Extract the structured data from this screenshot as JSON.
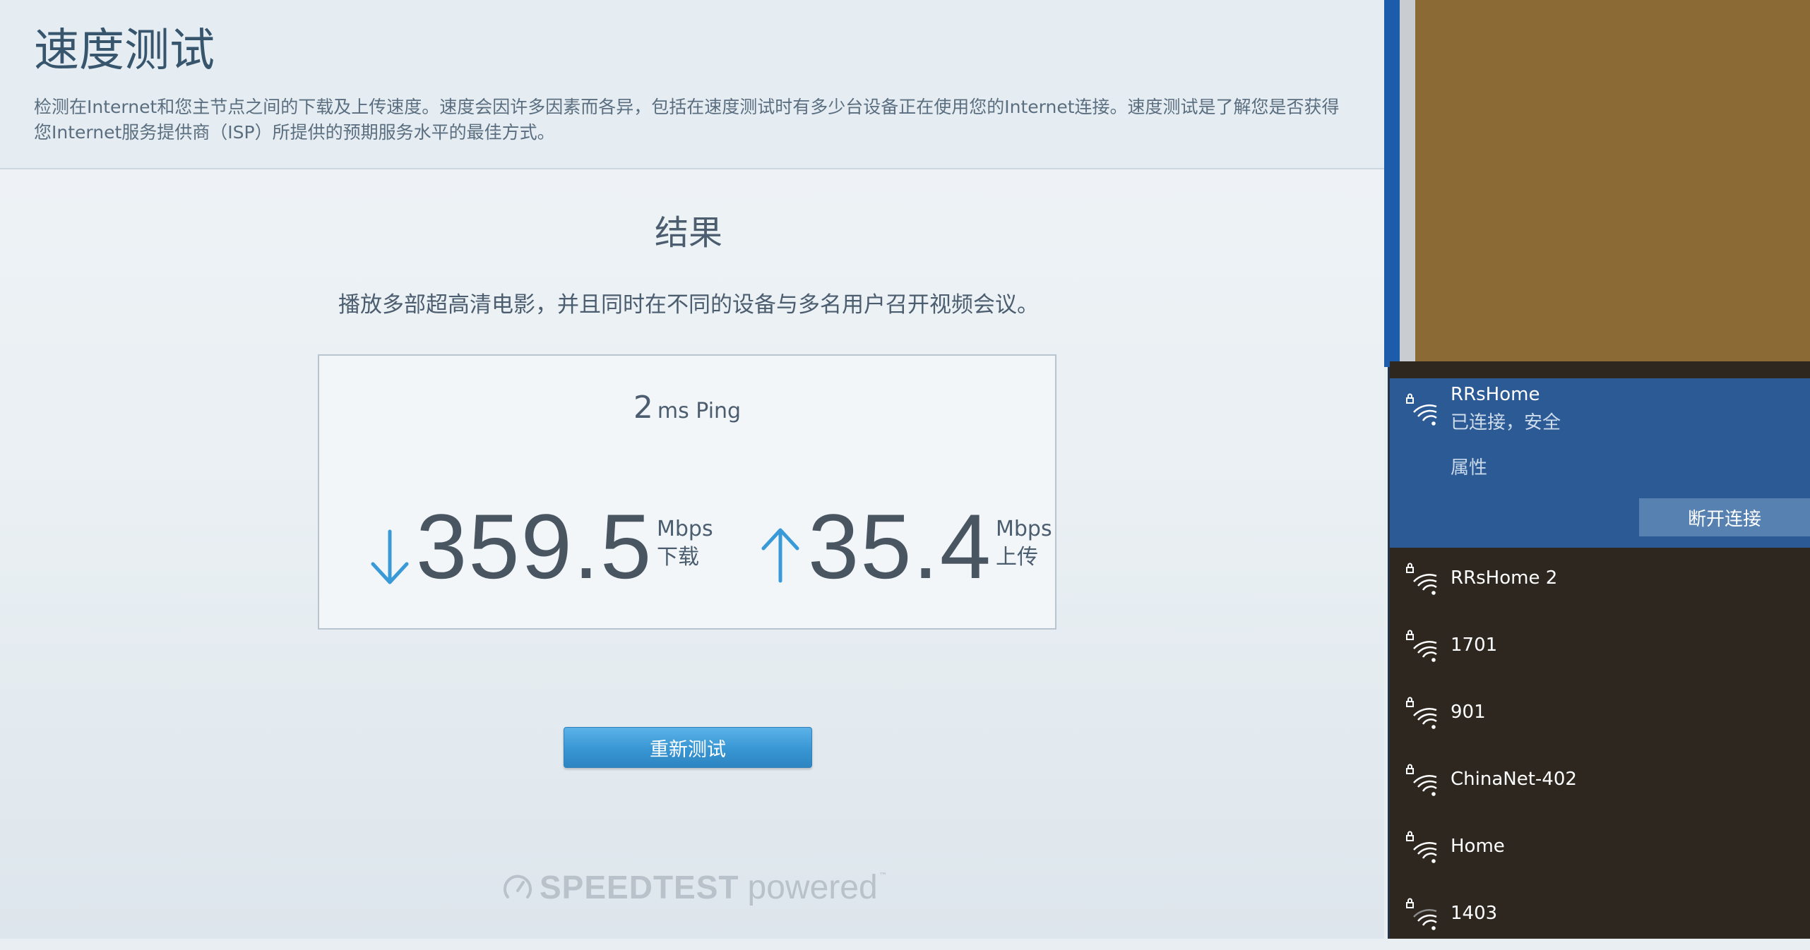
{
  "page": {
    "title": "速度测试",
    "description": "检测在Internet和您主节点之间的下载及上传速度。速度会因许多因素而各异，包括在速度测试时有多少台设备正在使用您的Internet连接。速度测试是了解您是否获得您Internet服务提供商（ISP）所提供的预期服务水平的最佳方式。"
  },
  "results": {
    "heading": "结果",
    "summary": "播放多部超高清电影，并且同时在不同的设备与多名用户召开视频会议。",
    "ping_value": "2",
    "ping_unit": "ms Ping",
    "download_value": "359.5",
    "download_unit": "Mbps",
    "download_label": "下载",
    "upload_value": "35.4",
    "upload_unit": "Mbps",
    "upload_label": "上传",
    "retest_label": "重新测试"
  },
  "branding": {
    "main": "SPEEDTEST",
    "sub": "powered",
    "tm": "™"
  },
  "wifi": {
    "connected": {
      "ssid": "RRsHome",
      "status": "已连接，安全",
      "properties_label": "属性",
      "disconnect_label": "断开连接"
    },
    "networks": [
      "RRsHome 2",
      "1701",
      "901",
      "ChinaNet-402",
      "Home",
      "1403"
    ]
  },
  "colors": {
    "accent": "#3a9ad8",
    "panel_bg": "#2e271f",
    "connected_bg": "#2b5a94",
    "disconnect_bg": "#5781b1",
    "desktop": "#8c6a36"
  },
  "icons": {
    "download": "arrow-down-icon",
    "upload": "arrow-up-icon",
    "wifi": "wifi-secured-icon",
    "brand": "speedometer-icon"
  }
}
